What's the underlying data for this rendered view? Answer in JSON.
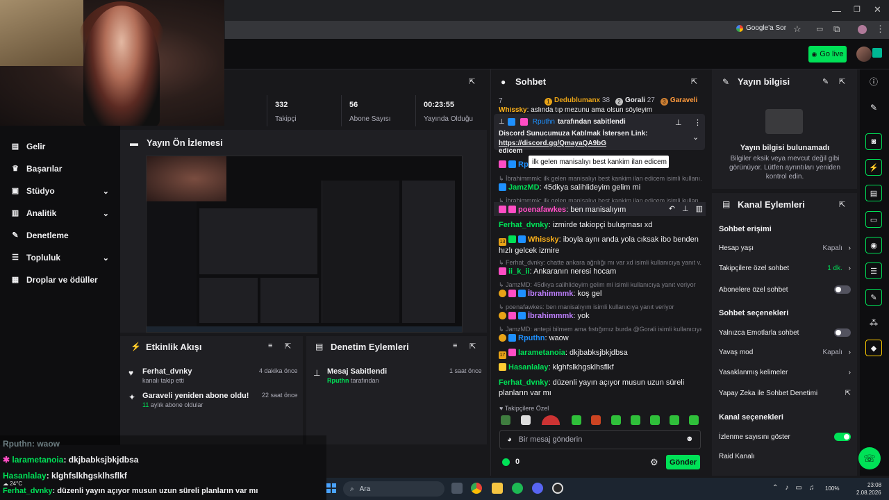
{
  "browser": {
    "google_btn": "Google'a Sor"
  },
  "header": {
    "go_live": "Go live"
  },
  "nav": {
    "items": [
      {
        "label": "Gelir",
        "icon": "dollar-icon"
      },
      {
        "label": "Başarılar",
        "icon": "trophy-icon"
      },
      {
        "label": "Stüdyo",
        "icon": "video-icon"
      },
      {
        "label": "Analitik",
        "icon": "chart-icon"
      },
      {
        "label": "Denetleme",
        "icon": "wrench-icon"
      },
      {
        "label": "Topluluk",
        "icon": "people-icon"
      },
      {
        "label": "Droplar ve ödüller",
        "icon": "gift-icon"
      }
    ]
  },
  "stats": [
    {
      "value": "332",
      "label": "Takipçi"
    },
    {
      "value": "56",
      "label": "Abone Sayısı"
    },
    {
      "value": "00:23:55",
      "label": "Yayında Olduğu Süre"
    }
  ],
  "preview": {
    "title": "Yayın Ön İzlemesi"
  },
  "activity": {
    "title": "Etkinlik Akışı",
    "items": [
      {
        "name": "Ferhat_dvnky",
        "sub": "kanalı takip etti",
        "time": "4 dakika önce"
      },
      {
        "name": "Garaveli yeniden abone oldu!",
        "sub_count": "11",
        "sub": "aylık abone oldular",
        "time": "22 saat önce"
      }
    ]
  },
  "moderation": {
    "title": "Denetim Eylemleri",
    "items": [
      {
        "name": "Mesaj Sabitlendi",
        "actor": "Rputhn",
        "sub": "tarafından",
        "time": "1 saat önce"
      }
    ]
  },
  "chat": {
    "title": "Sohbet",
    "leaderboard_partial": "7",
    "leaders": [
      {
        "rank": "1",
        "name": "Dedublumanx",
        "score": "38"
      },
      {
        "rank": "2",
        "name": "Gorali",
        "score": "27"
      },
      {
        "rank": "3",
        "name": "Garaveli",
        "score": ""
      }
    ],
    "cut_line_user": "Whissky",
    "cut_line_text": "aslında tıp mezunu ama olsun söyleyim",
    "pinned": {
      "by_user": "Rputhn",
      "by_text": "tarafından sabitlendi",
      "text": "Discord Sunucumuza Katılmak İstersen Link:",
      "link": "https://discord.gg/QmayaQA9bG"
    },
    "pinned_tail": "edicem",
    "tooltip": "ilk gelen manisalıyı best kankim ilan edicem",
    "partial_user": "Rp",
    "messages": [
      {
        "reply": "İbrahimmmk: ilk gelen manisalıyı best kankim ilan edicem isimli kullanı...",
        "user": "JamzMD",
        "color": "#00e157",
        "text": "45dkya salihlideyim gelim mi"
      },
      {
        "reply": "İbrahimmmk: ilk gelen manisalıyı best kankim ilan edicem isimli kullan...",
        "user": "poenafawkes",
        "color": "#ff4dc4",
        "text": "ben manisalıyım"
      },
      {
        "user": "Ferhat_dvnky",
        "color": "#00e157",
        "text": "izmirde takiopçi buluşması xd"
      },
      {
        "user": "Whissky",
        "color": "#ffb31a",
        "text": "iboyla aynı anda yola cıksak ibo benden hızlı gelcek izmire"
      },
      {
        "reply": "Ferhat_dvnky: chatte ankara ağrılığı mı var xd isimli kullanıcıya yanıt v...",
        "user": "ii_k_ii",
        "color": "#00e157",
        "text": "Ankaranın neresi hocam"
      },
      {
        "reply": "JamzMD: 45dkya salihlideyim gelim mi isimli kullanıcıya yanıt veriyor",
        "user": "İbrahimmmk",
        "color": "#bf7fff",
        "text": "koş gel"
      },
      {
        "reply": "poenafawkes: ben manisalıyım isimli kullanıcıya yanıt veriyor",
        "user": "İbrahimmmk",
        "color": "#bf7fff",
        "text": "yok"
      },
      {
        "reply": "JamzMD: antepi bilmem ama fıstığımız burda @Gorali isimli kullanıcıya ya...",
        "user": "Rputhn",
        "color": "#1e90ff",
        "text": "waow"
      },
      {
        "user": "larametanoia",
        "color": "#00e157",
        "text": "dkjbabksjbkjdbsa"
      },
      {
        "user": "Hasanlalay",
        "color": "#00e157",
        "text": "klghfslkhgsklhsflkf"
      },
      {
        "user": "Ferhat_dvnky",
        "color": "#00e157",
        "text": "düzenli yayın açıyor musun uzun süreli planların var mı"
      }
    ],
    "followers_only": "Takipçilere Özel",
    "input_placeholder": "Bir mesaj gönderin",
    "points": "0",
    "send": "Gönder",
    "badge_13": "13",
    "badge_17": "17"
  },
  "stream_info": {
    "title": "Yayın bilgisi",
    "empty_title": "Yayın bilgisi bulunamadı",
    "empty_text": "Bilgiler eksik veya mevcut değil gibi görünüyor. Lütfen ayrıntıları yeniden kontrol edin."
  },
  "channel_actions": {
    "title": "Kanal Eylemleri",
    "section1": "Sohbet erişimi",
    "rows1": [
      {
        "label": "Hesap yaşı",
        "value": "Kapalı",
        "kind": "chevron"
      },
      {
        "label": "Takipçilere özel sohbet",
        "value": "1 dk.",
        "kind": "chevron-green"
      },
      {
        "label": "Abonelere özel sohbet",
        "kind": "toggle-off"
      }
    ],
    "section2": "Sohbet seçenekleri",
    "rows2": [
      {
        "label": "Yalnızca Emotlarla sohbet",
        "kind": "toggle-off"
      },
      {
        "label": "Yavaş mod",
        "value": "Kapalı",
        "kind": "chevron"
      },
      {
        "label": "Yasaklanmış kelimeler",
        "kind": "chevron"
      },
      {
        "label": "Yapay Zeka ile Sohbet Denetimi",
        "kind": "external"
      }
    ],
    "section3": "Kanal seçenekleri",
    "rows3": [
      {
        "label": "İzlenme sayısını göster",
        "kind": "toggle-on"
      },
      {
        "label": "Raid Kanalı",
        "kind": "none"
      }
    ]
  },
  "overlay": {
    "lines": [
      {
        "user": "Rputhn",
        "text": ": waow",
        "dim": true
      },
      {
        "user": "larametanoia",
        "text": ": dkjbabksjbkjdbsa",
        "color": "#00e157"
      },
      {
        "user": "Hasanlalay",
        "text": ": klghfslkhgsklhsflkf",
        "color": "#00e157"
      },
      {
        "user": "Ferhat_dvnky",
        "text": ": düzenli yayın açıyor musun uzun süreli planların var mı",
        "color": "#00e157"
      }
    ]
  },
  "taskbar": {
    "search": "Ara",
    "temp": "24°C",
    "battery": "100%",
    "time": "23:08",
    "date": "2.08.2026"
  },
  "colors": {
    "accent": "#00e157",
    "bg": "#18181b",
    "panel": "#1f1f23"
  }
}
